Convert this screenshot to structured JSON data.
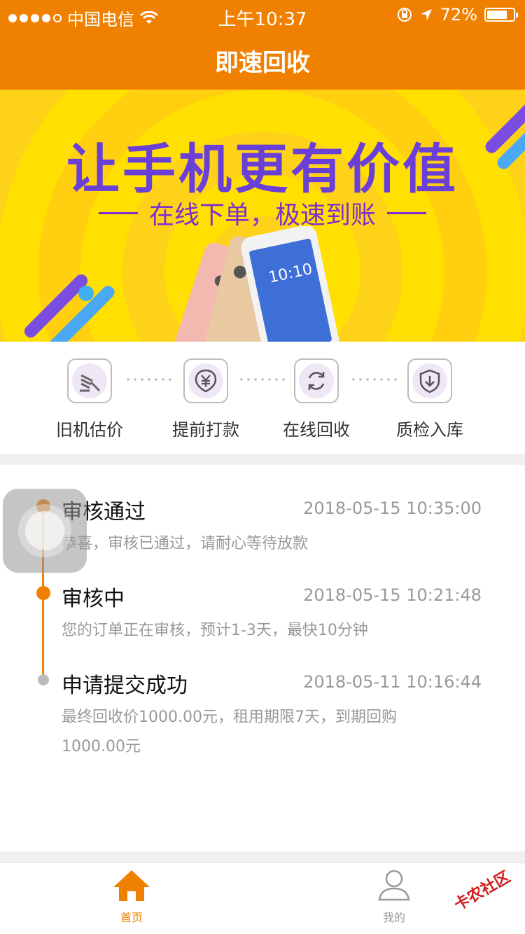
{
  "status_bar": {
    "carrier": "中国电信",
    "time": "上午10:37",
    "battery": "72%",
    "battery_level": 0.72
  },
  "header": {
    "title": "即速回收"
  },
  "banner": {
    "title": "让手机更有价值",
    "subtitle": "在线下单，极速到账",
    "phone_screen_time": "10:10"
  },
  "steps": [
    {
      "label": "旧机估价",
      "icon": "gavel-icon"
    },
    {
      "label": "提前打款",
      "icon": "yuan-shield-icon"
    },
    {
      "label": "在线回收",
      "icon": "recycle-arrows-icon"
    },
    {
      "label": "质检入库",
      "icon": "shield-download-icon"
    }
  ],
  "timeline": [
    {
      "title": "审核通过",
      "time": "2018-05-15 10:35:00",
      "desc": "恭喜，审核已通过，请耐心等待放款",
      "status": "active"
    },
    {
      "title": "审核中",
      "time": "2018-05-15 10:21:48",
      "desc": "您的订单正在审核，预计1-3天，最快10分钟",
      "status": "active"
    },
    {
      "title": "申请提交成功",
      "time": "2018-05-11 10:16:44",
      "desc": "最终回收价1000.00元，租用期限7天，到期回购1000.00元",
      "status": "done"
    }
  ],
  "tabs": [
    {
      "label": "首页",
      "icon": "home-icon",
      "active": true
    },
    {
      "label": "我的",
      "icon": "user-icon",
      "active": false
    }
  ],
  "watermark": "卡农社区",
  "colors": {
    "accent": "#f08000",
    "banner_yellow": "#ffe000",
    "banner_purple": "#6a3fd8",
    "inactive_grey": "#999999"
  }
}
